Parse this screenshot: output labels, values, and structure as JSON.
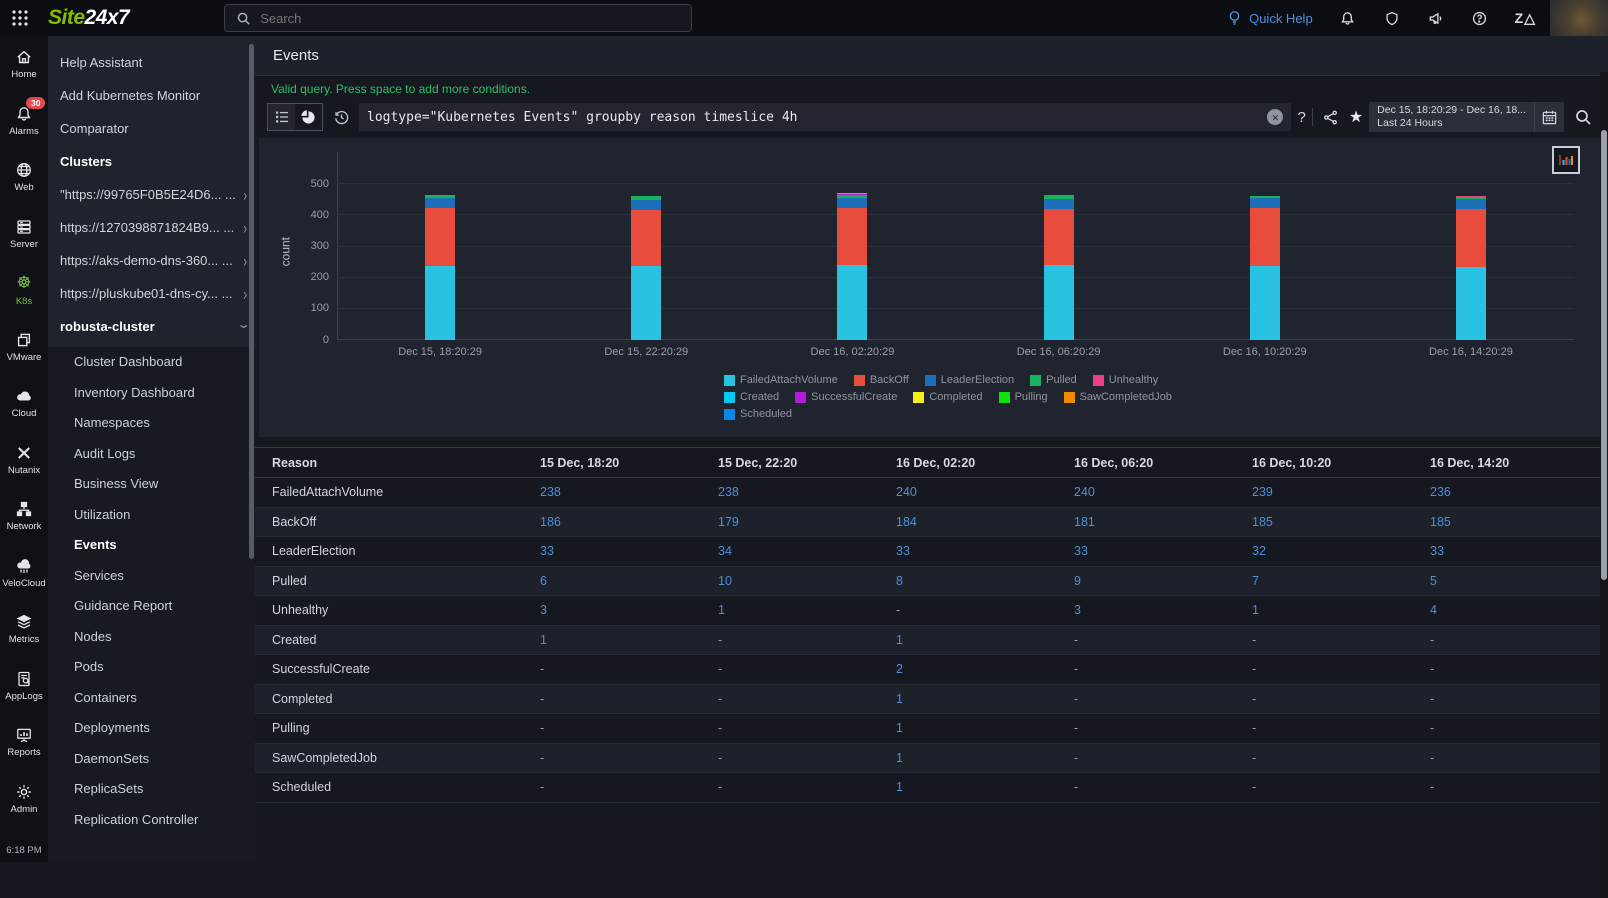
{
  "topbar": {
    "logo_site": "Site",
    "logo_rest": "24x7",
    "search_placeholder": "Search",
    "quick_help_label": "Quick Help"
  },
  "rail": {
    "items": [
      {
        "label": "Home",
        "icon": "home-icon"
      },
      {
        "label": "Alarms",
        "icon": "alarms-icon",
        "badge": "30"
      },
      {
        "label": "Web",
        "icon": "web-icon"
      },
      {
        "label": "Server",
        "icon": "server-icon"
      },
      {
        "label": "K8s",
        "icon": "k8s-icon",
        "active": true
      },
      {
        "label": "VMware",
        "icon": "vmware-icon"
      },
      {
        "label": "Cloud",
        "icon": "cloud-icon"
      },
      {
        "label": "Nutanix",
        "icon": "nutanix-icon"
      },
      {
        "label": "Network",
        "icon": "network-icon"
      },
      {
        "label": "VeloCloud",
        "icon": "velocloud-icon"
      },
      {
        "label": "Metrics",
        "icon": "metrics-icon"
      },
      {
        "label": "AppLogs",
        "icon": "applogs-icon"
      },
      {
        "label": "Reports",
        "icon": "reports-icon"
      },
      {
        "label": "Admin",
        "icon": "admin-icon"
      }
    ],
    "time": "6:18 PM"
  },
  "sidebar": {
    "top_items": [
      "Help Assistant",
      "Add Kubernetes Monitor",
      "Comparator"
    ],
    "clusters_header": "Clusters",
    "clusters": [
      "\"https://99765F0B5E24D6... ...",
      "https://1270398871824B9... ...",
      "https://aks-demo-dns-360... ...",
      "https://pluskube01-dns-cy... ..."
    ],
    "active_cluster": "robusta-cluster",
    "sub_items": [
      "Cluster Dashboard",
      "Inventory Dashboard",
      "Namespaces",
      "Audit Logs",
      "Business View",
      "Utilization",
      "Events",
      "Services",
      "Guidance Report",
      "Nodes",
      "Pods",
      "Containers",
      "Deployments",
      "DaemonSets",
      "ReplicaSets",
      "Replication Controller"
    ],
    "active_sub_item": "Events"
  },
  "main": {
    "title": "Events",
    "query_status": "Valid query. Press space to add more conditions.",
    "query": "logtype=\"Kubernetes Events\" groupby reason timeslice 4h",
    "time_range_line1": "Dec 15, 18:20:29 - Dec 16, 18...",
    "time_range_line2": "Last 24 Hours"
  },
  "chart_data": {
    "type": "bar",
    "stacked": true,
    "categories": [
      "Dec 15, 18:20:29",
      "Dec 15, 22:20:29",
      "Dec 16, 02:20:29",
      "Dec 16, 06:20:29",
      "Dec 16, 10:20:29",
      "Dec 16, 14:20:29"
    ],
    "series": [
      {
        "name": "FailedAttachVolume",
        "color": "#29c2e0",
        "values": [
          238,
          238,
          240,
          240,
          239,
          236
        ]
      },
      {
        "name": "BackOff",
        "color": "#e74c3c",
        "values": [
          186,
          179,
          184,
          181,
          185,
          185
        ]
      },
      {
        "name": "LeaderElection",
        "color": "#1e6fba",
        "values": [
          33,
          34,
          33,
          33,
          32,
          33
        ]
      },
      {
        "name": "Pulled",
        "color": "#17b35c",
        "values": [
          6,
          10,
          8,
          9,
          7,
          5
        ]
      },
      {
        "name": "Unhealthy",
        "color": "#ee3d80",
        "values": [
          3,
          1,
          0,
          3,
          1,
          4
        ]
      },
      {
        "name": "Created",
        "color": "#00c9f5",
        "values": [
          1,
          0,
          1,
          0,
          0,
          0
        ]
      },
      {
        "name": "SuccessfulCreate",
        "color": "#b01fd6",
        "values": [
          0,
          0,
          2,
          0,
          0,
          0
        ]
      },
      {
        "name": "Completed",
        "color": "#f7ef1a",
        "values": [
          0,
          0,
          1,
          0,
          0,
          0
        ]
      },
      {
        "name": "Pulling",
        "color": "#0ae20a",
        "values": [
          0,
          0,
          1,
          0,
          0,
          0
        ]
      },
      {
        "name": "SawCompletedJob",
        "color": "#ef8d00",
        "values": [
          0,
          0,
          1,
          0,
          0,
          0
        ]
      },
      {
        "name": "Scheduled",
        "color": "#0b84e8",
        "values": [
          0,
          0,
          1,
          0,
          0,
          0
        ]
      }
    ],
    "title": "",
    "xlabel": "",
    "ylabel": "count",
    "yticks": [
      0,
      100,
      200,
      300,
      400,
      500
    ],
    "ylim": [
      0,
      565
    ],
    "grid": true,
    "legend_position": "bottom",
    "legend_rows": [
      5,
      5,
      1
    ]
  },
  "table": {
    "columns": [
      "Reason",
      "15 Dec, 18:20",
      "15 Dec, 22:20",
      "16 Dec, 02:20",
      "16 Dec, 06:20",
      "16 Dec, 10:20",
      "16 Dec, 14:20"
    ],
    "rows": [
      {
        "reason": "FailedAttachVolume",
        "values": [
          "238",
          "238",
          "240",
          "240",
          "239",
          "236"
        ]
      },
      {
        "reason": "BackOff",
        "values": [
          "186",
          "179",
          "184",
          "181",
          "185",
          "185"
        ]
      },
      {
        "reason": "LeaderElection",
        "values": [
          "33",
          "34",
          "33",
          "33",
          "32",
          "33"
        ]
      },
      {
        "reason": "Pulled",
        "values": [
          "6",
          "10",
          "8",
          "9",
          "7",
          "5"
        ]
      },
      {
        "reason": "Unhealthy",
        "values": [
          "3",
          "1",
          "-",
          "3",
          "1",
          "4"
        ]
      },
      {
        "reason": "Created",
        "values": [
          "1",
          "-",
          "1",
          "-",
          "-",
          "-"
        ]
      },
      {
        "reason": "SuccessfulCreate",
        "values": [
          "-",
          "-",
          "2",
          "-",
          "-",
          "-"
        ]
      },
      {
        "reason": "Completed",
        "values": [
          "-",
          "-",
          "1",
          "-",
          "-",
          "-"
        ]
      },
      {
        "reason": "Pulling",
        "values": [
          "-",
          "-",
          "1",
          "-",
          "-",
          "-"
        ]
      },
      {
        "reason": "SawCompletedJob",
        "values": [
          "-",
          "-",
          "1",
          "-",
          "-",
          "-"
        ]
      },
      {
        "reason": "Scheduled",
        "values": [
          "-",
          "-",
          "1",
          "-",
          "-",
          "-"
        ]
      }
    ]
  },
  "colors": {
    "accent_green": "#84bd00",
    "status_green": "#2fbf67",
    "link_blue": "#4f8ed9",
    "quick_help_blue": "#4a90e2",
    "alarm_badge_red": "#e5484d"
  }
}
